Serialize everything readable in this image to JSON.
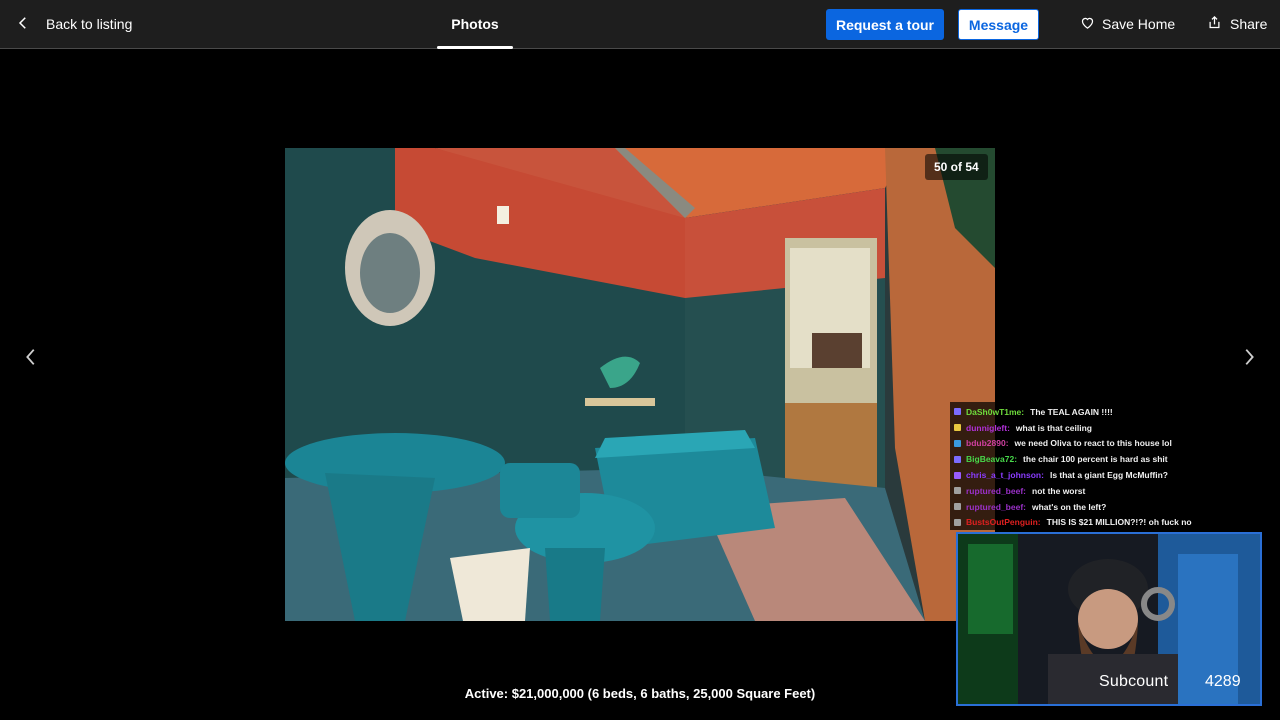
{
  "topbar": {
    "back_label": "Back to listing",
    "active_tab": "Photos",
    "request_tour_label": "Request a tour",
    "message_label": "Message",
    "save_label": "Save Home",
    "share_label": "Share"
  },
  "gallery": {
    "counter": "50 of 54",
    "current_photo": 50,
    "total_photos": 54
  },
  "listing": {
    "summary": "Active: $21,000,000 (6 beds, 6 baths, 25,000 Square Feet)"
  },
  "stream": {
    "chat": [
      {
        "user": "DaSh0wT1me",
        "message": "The TEAL AGAIN !!!!",
        "color": "#6fdc3c",
        "badge": "#7b6cff"
      },
      {
        "user": "dunnigleft",
        "message": "what is that ceiling",
        "color": "#b030d8",
        "badge": "#e8c840"
      },
      {
        "user": "bdub2890",
        "message": "we need Oliva to react to this house lol",
        "color": "#d040a0",
        "badge": "#3a9be0"
      },
      {
        "user": "BigBeava72",
        "message": "the chair 100 percent is hard as shit",
        "color": "#48d84a",
        "badge": "#7b6cff"
      },
      {
        "user": "chris_a_t_johnson",
        "message": "Is that a giant Egg McMuffin?",
        "color": "#8a3cff",
        "badge": "#9a5cff"
      },
      {
        "user": "ruptured_beef",
        "message": "not the worst",
        "color": "#9a30c8",
        "badge": "#a0a0a0"
      },
      {
        "user": "ruptured_beef",
        "message": "what's on the left?",
        "color": "#9a30c8",
        "badge": "#a0a0a0"
      },
      {
        "user": "BustsOutPenguin",
        "message": "THIS IS $21 MILLION?!?! oh fuck no",
        "color": "#e02020",
        "badge": "#a0a0a0"
      }
    ],
    "subcount_label": "Subcount",
    "subcount_value": "4289"
  },
  "colors": {
    "primary_button": "#0b66e0",
    "topbar_bg": "#1e1e1e",
    "page_bg": "#000000",
    "cam_border": "#2a6fd6"
  },
  "icons": {
    "back": "chevron-left-icon",
    "save": "heart-icon",
    "share": "share-icon",
    "prev": "chevron-left-icon",
    "next": "chevron-right-icon"
  }
}
